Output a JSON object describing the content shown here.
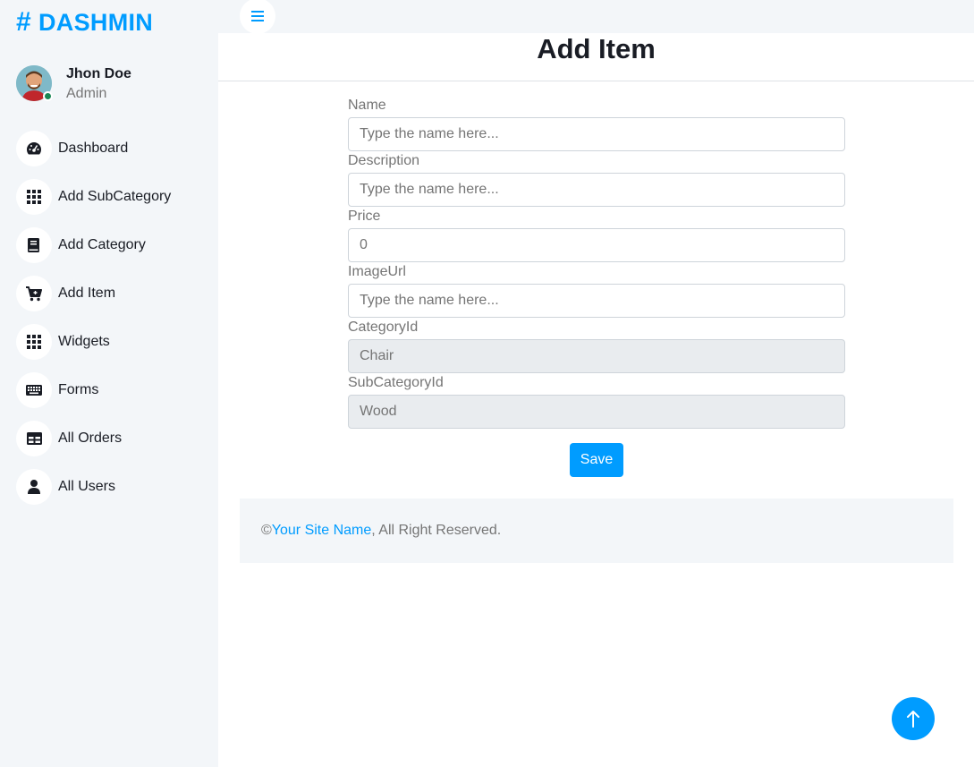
{
  "brand": {
    "symbol": "#",
    "name": "DASHMIN"
  },
  "user": {
    "name": "Jhon Doe",
    "role": "Admin",
    "status": "online"
  },
  "colors": {
    "accent": "#009cff",
    "sidebar_bg": "#f3f6f9",
    "dark_text": "#191c24",
    "muted_text": "#757575",
    "online": "#198754"
  },
  "sidebar": {
    "items": [
      {
        "label": "Dashboard",
        "icon": "tachometer-icon"
      },
      {
        "label": "Add SubCategory",
        "icon": "grid-icon"
      },
      {
        "label": "Add Category",
        "icon": "book-icon"
      },
      {
        "label": "Add Item",
        "icon": "cart-plus-icon"
      },
      {
        "label": "Widgets",
        "icon": "grid-icon"
      },
      {
        "label": "Forms",
        "icon": "keyboard-icon"
      },
      {
        "label": "All Orders",
        "icon": "table-icon"
      },
      {
        "label": "All Users",
        "icon": "user-icon"
      }
    ]
  },
  "topbar": {
    "toggle_icon": "menu-icon"
  },
  "page": {
    "title": "Add Item"
  },
  "form": {
    "name": {
      "label": "Name",
      "placeholder": "Type the name here..."
    },
    "description": {
      "label": "Description",
      "placeholder": "Type the name here..."
    },
    "price": {
      "label": "Price",
      "value": "0"
    },
    "image_url": {
      "label": "ImageUrl",
      "placeholder": "Type the name here..."
    },
    "category_id": {
      "label": "CategoryId",
      "value": "Chair"
    },
    "subcategory_id": {
      "label": "SubCategoryId",
      "value": "Wood"
    },
    "save_label": "Save"
  },
  "footer": {
    "prefix": "© ",
    "site_name": "Your Site Name",
    "suffix": ", All Right Reserved."
  },
  "back_to_top": {
    "icon": "arrow-up-icon"
  }
}
